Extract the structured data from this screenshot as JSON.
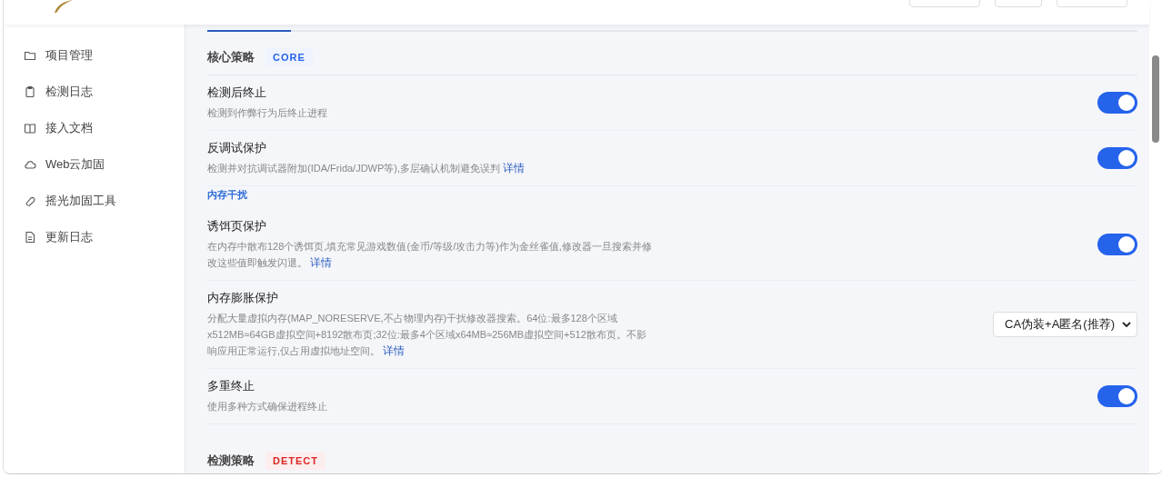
{
  "header": {
    "buttons": [
      {
        "kind": "wide"
      },
      {
        "kind": "narrow"
      },
      {
        "kind": "wide"
      }
    ]
  },
  "sidebar": {
    "items": [
      {
        "label": "项目管理"
      },
      {
        "label": "检测日志"
      },
      {
        "label": "接入文档"
      },
      {
        "label": "Web云加固"
      },
      {
        "label": "摇光加固工具"
      },
      {
        "label": "更新日志"
      }
    ]
  },
  "sections": [
    {
      "title": "核心策略",
      "badge": "CORE",
      "color": "#2563eb",
      "items": [
        {
          "kind": "toggle",
          "title": "检测后终止",
          "description": "检测到作弊行为后终止进程",
          "on": true
        },
        {
          "kind": "toggle",
          "title": "反调试保护",
          "description": "检测并对抗调试器附加(IDA/Frida/JDWP等),多层确认机制避免误判",
          "link": "详情",
          "on": true
        },
        {
          "kind": "subheading",
          "title": "内存干扰"
        },
        {
          "kind": "toggle",
          "title": "诱饵页保护",
          "description": "在内存中散布128个诱饵页,填充常见游戏数值(金币/等级/攻击力等)作为金丝雀值,修改器一旦搜索并修改这些值即触发闪退。",
          "link": "详情",
          "on": true
        },
        {
          "kind": "select",
          "title": "内存膨胀保护",
          "description": "分配大量虚拟内存(MAP_NORESERVE,不占物理内存)干扰修改器搜索。64位:最多128个区域x512MB≈64GB虚拟空间+8192散布页;32位:最多4个区域x64MB≈256MB虚拟空间+512散布页。不影响应用正常运行,仅占用虚拟地址空间。",
          "link": "详情",
          "value": "CA伪装+A匿名(推荐)"
        },
        {
          "kind": "toggle",
          "title": "多重终止",
          "description": "使用多种方式确保进程终止",
          "on": true
        }
      ]
    },
    {
      "title": "检测策略",
      "badge": "DETECT",
      "color": "#dc2626"
    }
  ]
}
